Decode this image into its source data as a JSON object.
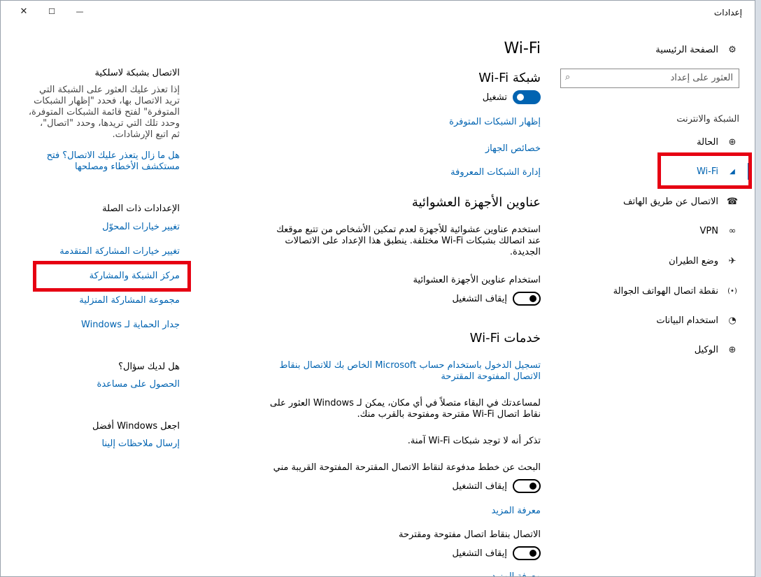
{
  "window": {
    "title": "إعدادات",
    "close_glyph": "✕",
    "max_glyph": "☐",
    "min_glyph": "—"
  },
  "sidebar": {
    "home": "الصفحة الرئيسية",
    "search_placeholder": "العثور على إعداد",
    "category": "الشبكة والانترنت",
    "items": [
      {
        "label": "الحالة",
        "icon": "globe-status-icon",
        "glyph": "⊕"
      },
      {
        "label": "Wi-Fi",
        "icon": "wifi-icon",
        "glyph": "◢",
        "selected": true
      },
      {
        "label": "الاتصال عن طريق الهاتف",
        "icon": "dialup-icon",
        "glyph": "☎"
      },
      {
        "label": "VPN",
        "icon": "vpn-icon",
        "glyph": "∞"
      },
      {
        "label": "وضع الطيران",
        "icon": "airplane-icon",
        "glyph": "✈"
      },
      {
        "label": "نقطة اتصال الهواتف الجوالة",
        "icon": "hotspot-icon",
        "glyph": "(•)"
      },
      {
        "label": "استخدام البيانات",
        "icon": "data-usage-icon",
        "glyph": "◔"
      },
      {
        "label": "الوكيل",
        "icon": "proxy-globe-icon",
        "glyph": "⊕"
      }
    ]
  },
  "main": {
    "page_title": "Wi-Fi",
    "wifi_network_heading": "شبكة Wi-Fi",
    "wifi_toggle_label": "تشغيل",
    "links": {
      "show_available": "إظهار الشبكات المتوفرة",
      "hardware_props": "خصائص الجهاز",
      "manage_known": "إدارة الشبكات المعروفة"
    },
    "random_heading": "عناوين الأجهزة العشوائية",
    "random_desc_1": "استخدم عناوين عشوائية للأجهزة لعدم تمكين الأشخاص من تتبع موقعك",
    "random_desc_2": "عند اتصالك بشبكات Wi-Fi مختلفة. ينطبق هذا الإعداد على الاتصالات",
    "random_desc_3": "الجديدة.",
    "random_toggle_title": "استخدام عناوين الأجهزة العشوائية",
    "off_label": "إيقاف التشغيل",
    "services_heading": "خدمات Wi-Fi",
    "signin_link_1": "تسجيل الدخول باستخدام حساب Microsoft الخاص بك للاتصال بنقاط",
    "signin_link_2": "الاتصال المفتوحة المقترحة",
    "help_text_1": "لمساعدتك في البقاء متصلاً في أي مكان، يمكن لـ Windows العثور على",
    "help_text_2": "نقاط اتصال Wi-Fi مقترحة ومفتوحة بالقرب منك.",
    "remember_text": "تذكر أنه لا توجد شبكات Wi-Fi آمنة.",
    "paid_plans_title": "البحث عن خطط مدفوعة لنقاط الاتصال المقترحة المفتوحة القريبة مني",
    "learn_more": "معرفة المزيد",
    "connect_open_title": "الاتصال بنقاط اتصال مفتوحة ومقترحة",
    "learn_more_2": "معرفة المزيد"
  },
  "aside": {
    "wireless_heading": "الاتصال بشبكة لاسلكية",
    "wireless_desc": [
      "إذا تعذر عليك العثور على الشبكة التي",
      "تريد الاتصال بها، فحدد \"إظهار الشبكات",
      "المتوفرة\" لفتح قائمة الشبكات المتوفرة،",
      "وحدد تلك التي تريدها، وحدد \"اتصال\"،",
      "ثم اتبع الإرشادات."
    ],
    "troubleshoot_link_1": "هل ما زال يتعذر عليك الاتصال؟ فتح",
    "troubleshoot_link_2": "مستكشف الأخطاء ومصلحها",
    "related_heading": "الإعدادات ذات الصلة",
    "related_links": [
      "تغيير خيارات المحوّل",
      "تغيير خيارات المشاركة المتقدمة",
      "مركز الشبكة والمشاركة",
      "مجموعة المشاركة المنزلية",
      "جدار الحماية لـ Windows"
    ],
    "question_heading": "هل لديك سؤال؟",
    "get_help": "الحصول على مساعدة",
    "better_heading": "اجعل Windows أفضل",
    "feedback": "إرسال ملاحظات إلينا"
  },
  "colors": {
    "accent": "#0063b1",
    "highlight": "#e60012"
  }
}
